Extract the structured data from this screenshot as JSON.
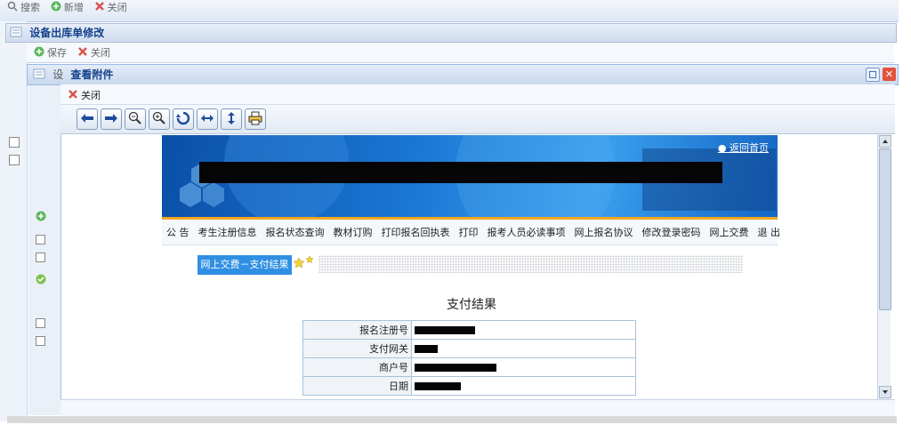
{
  "top_toolbar": {
    "search_label": "搜索",
    "add_label": "新增",
    "close_label": "关闭"
  },
  "outer_panel": {
    "title": "设备出库单修改",
    "save_label": "保存",
    "close_label": "关闭",
    "tab_peek": "设"
  },
  "dialog": {
    "title": "查看附件",
    "close_label": "关闭"
  },
  "viewer_toolbar": {
    "buttons": [
      "arrow-left-icon",
      "arrow-right-icon",
      "zoom-out-icon",
      "zoom-in-icon",
      "rotate-icon",
      "fit-width-icon",
      "fit-height-icon",
      "print-icon"
    ]
  },
  "page": {
    "home_link": "返回首页",
    "nav_items": [
      "公 告",
      "考生注册信息",
      "报名状态查询",
      "教材订购",
      "打印报名回执表",
      "打印",
      "报考人员必读事项",
      "网上报名协议",
      "修改登录密码",
      "网上交费",
      "退 出"
    ],
    "breadcrumb_tag": "网上交费－支付结果",
    "result_title": "支付结果",
    "rows": [
      {
        "label": "报名注册号"
      },
      {
        "label": "支付网关"
      },
      {
        "label": "商户号"
      },
      {
        "label": "日期"
      }
    ]
  },
  "colors": {
    "accent": "#2f8fe3",
    "dialog_title": "#15428b",
    "nav_underline": "#f5a623"
  }
}
